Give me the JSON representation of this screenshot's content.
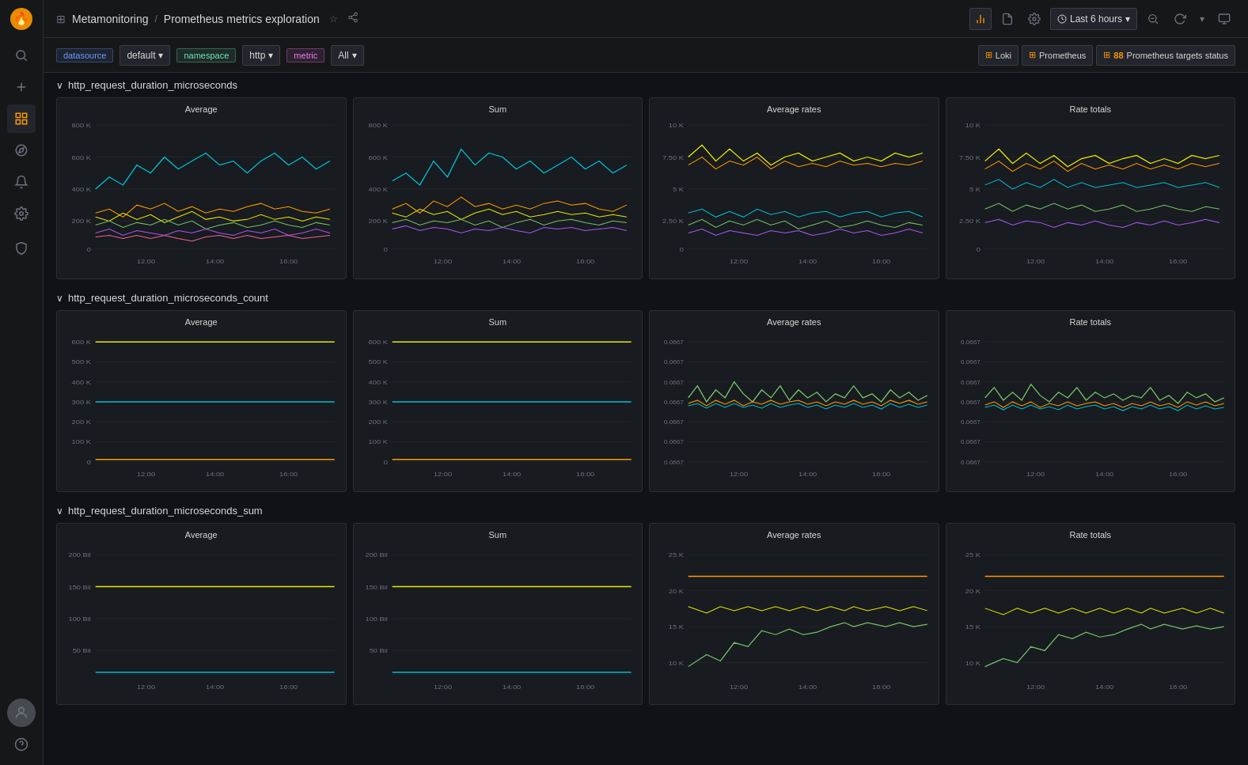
{
  "app": {
    "logo_icon": "🔥",
    "title_icon": "⊞",
    "breadcrumb_part1": "Metamonitoring",
    "breadcrumb_separator": "/",
    "breadcrumb_part2": "Prometheus metrics exploration",
    "star_icon": "☆",
    "share_icon": "⋯"
  },
  "topbar_right": {
    "bar_chart_icon": "📊",
    "docs_icon": "📄",
    "settings_icon": "⚙",
    "time_range": "Last 6 hours",
    "zoom_out_icon": "🔍",
    "refresh_icon": "↻",
    "dropdown_icon": "▾",
    "tv_icon": "⬛"
  },
  "filters": {
    "datasource_label": "datasource",
    "datasource_value": "default",
    "namespace_label": "namespace",
    "namespace_value": "http",
    "metric_label": "metric",
    "metric_value": "All"
  },
  "tab_links": [
    {
      "id": "loki",
      "label": "Loki",
      "color": "#ff9900",
      "icon": "⊞"
    },
    {
      "id": "prometheus",
      "label": "Prometheus",
      "color": "#ff9900",
      "icon": "⊞"
    },
    {
      "id": "prometheus_targets",
      "label": "Prometheus targets status",
      "color": "#ff9900",
      "icon": "⊞",
      "badge": "88"
    }
  ],
  "sidebar": {
    "items": [
      {
        "id": "search",
        "icon": "🔍",
        "label": "Search"
      },
      {
        "id": "plus",
        "icon": "+",
        "label": "Add"
      },
      {
        "id": "grid",
        "icon": "⊞",
        "label": "Dashboards"
      },
      {
        "id": "compass",
        "icon": "◎",
        "label": "Explore"
      },
      {
        "id": "bell",
        "icon": "🔔",
        "label": "Alerts"
      },
      {
        "id": "settings",
        "icon": "⚙",
        "label": "Settings"
      },
      {
        "id": "shield",
        "icon": "🛡",
        "label": "Security"
      }
    ],
    "bottom_items": [
      {
        "id": "avatar",
        "icon": "👤",
        "label": "User"
      },
      {
        "id": "help",
        "icon": "?",
        "label": "Help"
      }
    ]
  },
  "sections": [
    {
      "id": "section1",
      "title": "http_request_duration_microseconds",
      "collapsed": false,
      "charts": [
        {
          "id": "avg1",
          "title": "Average",
          "y_labels": [
            "800 K",
            "600 K",
            "400 K",
            "200 K",
            "0"
          ],
          "x_labels": [
            "12:00",
            "14:00",
            "16:00"
          ]
        },
        {
          "id": "sum1",
          "title": "Sum",
          "y_labels": [
            "800 K",
            "600 K",
            "400 K",
            "200 K",
            "0"
          ],
          "x_labels": [
            "12:00",
            "14:00",
            "16:00"
          ]
        },
        {
          "id": "avgrate1",
          "title": "Average rates",
          "y_labels": [
            "10 K",
            "7.50 K",
            "5 K",
            "2.50 K",
            "0"
          ],
          "x_labels": [
            "12:00",
            "14:00",
            "16:00"
          ]
        },
        {
          "id": "ratetotal1",
          "title": "Rate totals",
          "y_labels": [
            "10 K",
            "7.50 K",
            "5 K",
            "2.50 K",
            "0"
          ],
          "x_labels": [
            "12:00",
            "14:00",
            "16:00"
          ]
        }
      ]
    },
    {
      "id": "section2",
      "title": "http_request_duration_microseconds_count",
      "collapsed": false,
      "charts": [
        {
          "id": "avg2",
          "title": "Average",
          "y_labels": [
            "600 K",
            "500 K",
            "400 K",
            "300 K",
            "200 K",
            "100 K",
            "0"
          ],
          "x_labels": [
            "12:00",
            "14:00",
            "16:00"
          ]
        },
        {
          "id": "sum2",
          "title": "Sum",
          "y_labels": [
            "600 K",
            "500 K",
            "400 K",
            "300 K",
            "200 K",
            "100 K",
            "0"
          ],
          "x_labels": [
            "12:00",
            "14:00",
            "16:00"
          ]
        },
        {
          "id": "avgrate2",
          "title": "Average rates",
          "y_labels": [
            "0.0667",
            "0.0667",
            "0.0667",
            "0.0667",
            "0.0667",
            "0.0667",
            "0.0667"
          ],
          "x_labels": [
            "12:00",
            "14:00",
            "16:00"
          ]
        },
        {
          "id": "ratetotal2",
          "title": "Rate totals",
          "y_labels": [
            "0.0667",
            "0.0667",
            "0.0667",
            "0.0667",
            "0.0667",
            "0.0667",
            "0.0667"
          ],
          "x_labels": [
            "12:00",
            "14:00",
            "16:00"
          ]
        }
      ]
    },
    {
      "id": "section3",
      "title": "http_request_duration_microseconds_sum",
      "collapsed": false,
      "charts": [
        {
          "id": "avg3",
          "title": "Average",
          "y_labels": [
            "200 Bil",
            "150 Bil",
            "100 Bil",
            "50 Bil"
          ],
          "x_labels": [
            "12:00",
            "14:00",
            "16:00"
          ]
        },
        {
          "id": "sum3",
          "title": "Sum",
          "y_labels": [
            "200 Bil",
            "150 Bil",
            "100 Bil",
            "50 Bil"
          ],
          "x_labels": [
            "12:00",
            "14:00",
            "16:00"
          ]
        },
        {
          "id": "avgrate3",
          "title": "Average rates",
          "y_labels": [
            "25 K",
            "20 K",
            "15 K",
            "10 K"
          ],
          "x_labels": [
            "12:00",
            "14:00",
            "16:00"
          ]
        },
        {
          "id": "ratetotal3",
          "title": "Rate totals",
          "y_labels": [
            "25 K",
            "20 K",
            "15 K",
            "10 K"
          ],
          "x_labels": [
            "12:00",
            "14:00",
            "16:00"
          ]
        }
      ]
    }
  ]
}
